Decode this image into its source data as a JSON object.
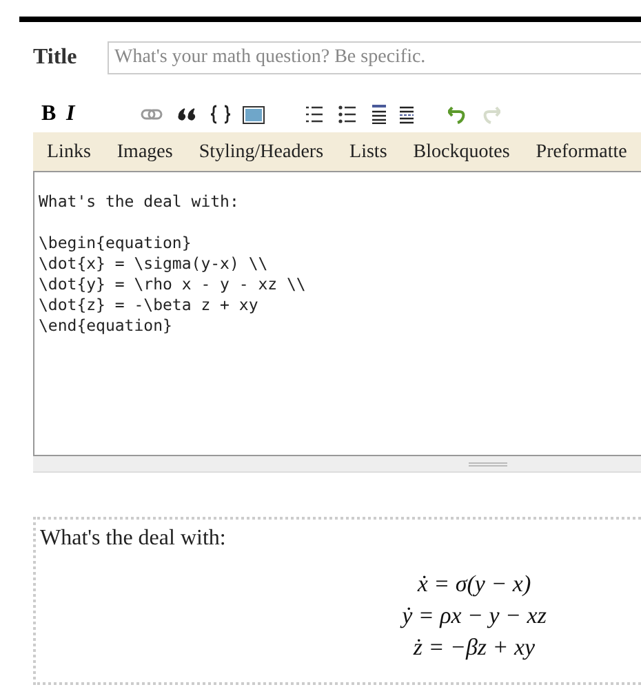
{
  "title_field": {
    "label": "Title",
    "placeholder": "What's your math question? Be specific."
  },
  "toolbar": {
    "bold": "B",
    "italic": "I",
    "history": [
      {
        "kind": "undo",
        "disabled": false
      },
      {
        "kind": "redo",
        "disabled": true
      }
    ]
  },
  "help_tabs": [
    "Links",
    "Images",
    "Styling/Headers",
    "Lists",
    "Blockquotes",
    "Preformatte"
  ],
  "editor": {
    "value": "What's the deal with:\n\n\\begin{equation}\n\\dot{x} = \\sigma(y-x) \\\\\n\\dot{y} = \\rho x - y - xz \\\\\n\\dot{z} = -\\beta z + xy\n\\end{equation}"
  },
  "preview": {
    "intro": "What's the deal with:",
    "equations": [
      "ẋ = σ(y − x)",
      "ẏ = ρx − y − xz",
      "ż = −βz + xy"
    ]
  }
}
